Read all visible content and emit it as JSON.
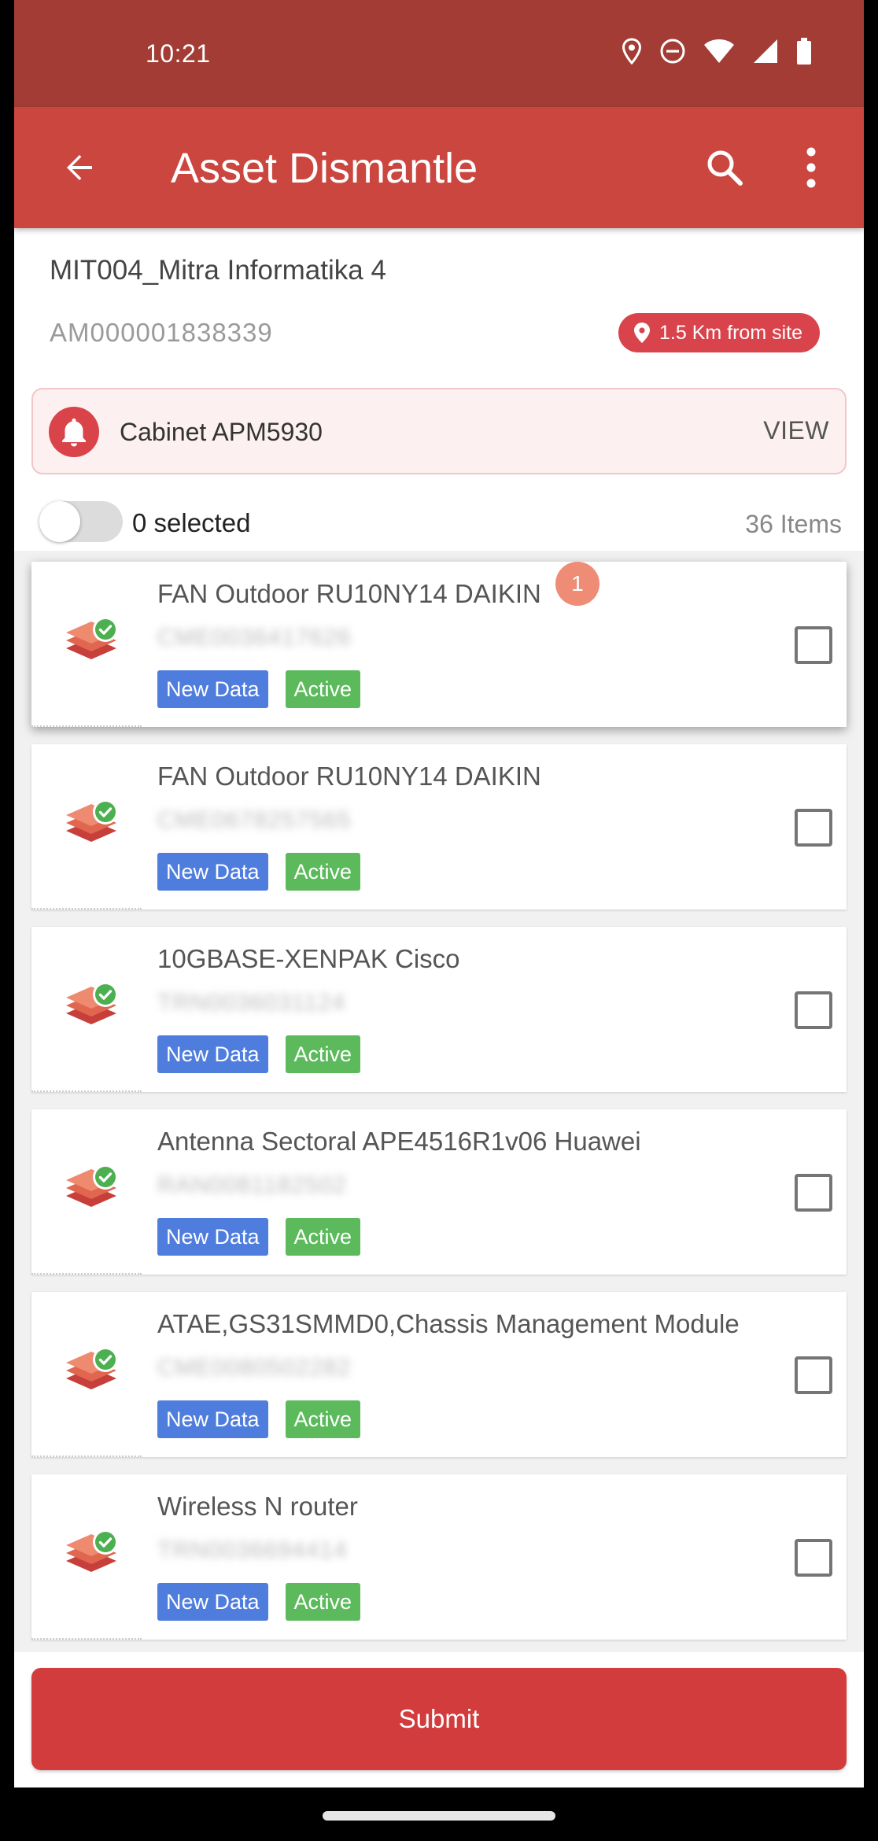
{
  "status_bar": {
    "time": "10:21",
    "icons": [
      "location-icon",
      "dnd-icon",
      "wifi-icon",
      "signal-icon",
      "battery-icon"
    ]
  },
  "app_bar": {
    "title": "Asset Dismantle",
    "back_icon": "arrow-back-icon",
    "search_icon": "search-icon",
    "menu_icon": "more-vert-icon"
  },
  "site": {
    "name": "MIT004_Mitra Informatika 4",
    "asset_id": "AM000001838339",
    "distance": "1.5 Km from site"
  },
  "cabinet": {
    "label": "Cabinet APM5930",
    "action": "VIEW"
  },
  "selection": {
    "selected_text": "0 selected",
    "items_count": "36 Items",
    "toggle_on": false
  },
  "items": [
    {
      "name": "FAN Outdoor RU10NY14 DAIKIN",
      "serial": "CME0036417626",
      "tags": [
        "New Data",
        "Active"
      ],
      "badge": "1",
      "checked": false
    },
    {
      "name": "FAN Outdoor RU10NY14 DAIKIN",
      "serial": "CME0678257565",
      "tags": [
        "New Data",
        "Active"
      ],
      "checked": false
    },
    {
      "name": "10GBASE-XENPAK Cisco",
      "serial": "TRN0036031124",
      "tags": [
        "New Data",
        "Active"
      ],
      "checked": false
    },
    {
      "name": "Antenna Sectoral APE4516R1v06 Huawei",
      "serial": "RAN0081182502",
      "tags": [
        "New Data",
        "Active"
      ],
      "checked": false
    },
    {
      "name": "ATAE,GS31SMMD0,Chassis Management Module",
      "serial": "CME0080502282",
      "tags": [
        "New Data",
        "Active"
      ],
      "checked": false
    },
    {
      "name": "Wireless N router",
      "serial": "TRN0036694414",
      "tags": [
        "New Data",
        "Active"
      ],
      "checked": false
    }
  ],
  "footer": {
    "submit_label": "Submit"
  },
  "colors": {
    "status_bar": "#a23c35",
    "app_bar": "#cc4640",
    "tag_new": "#4f7ddd",
    "tag_active": "#5cba5c",
    "submit": "#d23c3c"
  }
}
